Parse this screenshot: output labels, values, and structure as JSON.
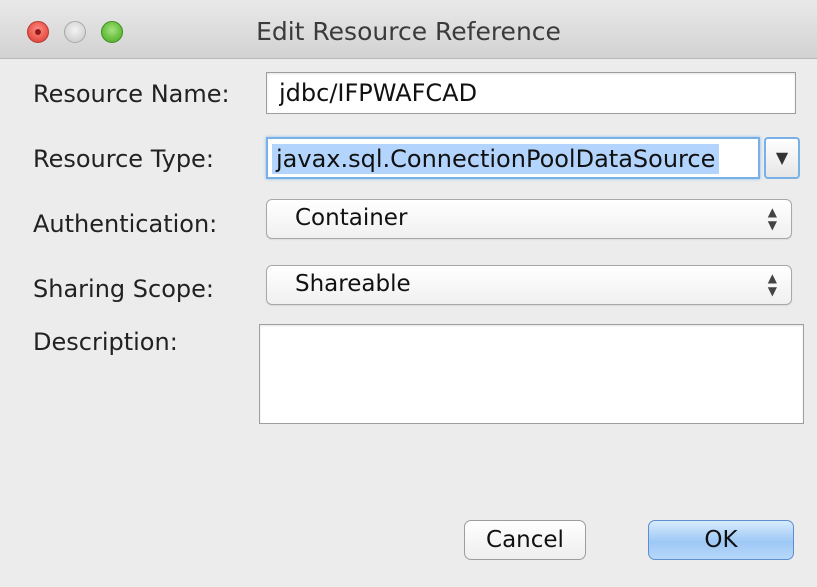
{
  "window": {
    "title": "Edit Resource Reference"
  },
  "form": {
    "resource_name": {
      "label": "Resource Name:",
      "value": "jdbc/IFPWAFCAD"
    },
    "resource_type": {
      "label": "Resource Type:",
      "value": "javax.sql.ConnectionPoolDataSource",
      "dropdown_icon": "triangle-down"
    },
    "authentication": {
      "label": "Authentication:",
      "value": "Container"
    },
    "sharing_scope": {
      "label": "Sharing Scope:",
      "value": "Shareable"
    },
    "description": {
      "label": "Description:",
      "value": ""
    }
  },
  "buttons": {
    "cancel": "Cancel",
    "ok": "OK"
  },
  "colors": {
    "close": "#ec5b51",
    "zoom": "#6cc241",
    "selection": "#b3d4fc",
    "default_button": "#9ec8f5"
  }
}
